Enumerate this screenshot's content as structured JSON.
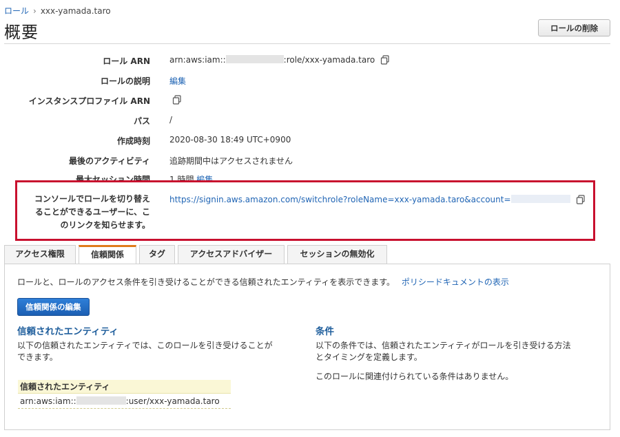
{
  "breadcrumb": {
    "parent": "ロール",
    "separator": "›",
    "current": "xxx-yamada.taro"
  },
  "page_title": "概要",
  "delete_button": "ロールの削除",
  "summary": {
    "role_arn": {
      "label": "ロール ARN",
      "prefix": "arn:aws:iam::",
      "suffix": ":role/xxx-yamada.taro"
    },
    "description": {
      "label": "ロールの説明",
      "link": "編集"
    },
    "instance_profile": {
      "label": "インスタンスプロファイル ARN"
    },
    "path": {
      "label": "パス",
      "value": "/"
    },
    "created": {
      "label": "作成時刻",
      "value": "2020-08-30 18:49 UTC+0900"
    },
    "last_activity": {
      "label": "最後のアクティビティ",
      "value": "追跡期間中はアクセスされません"
    },
    "max_session": {
      "label": "最大セッション時間",
      "value": "1 時間",
      "link": "編集"
    },
    "switch_link": {
      "label_lines": [
        "コンソールでロールを切り替え",
        "ることができるユーザーに、こ",
        "のリンクを知らせます。"
      ],
      "url": "https://signin.aws.amazon.com/switchrole?roleName=xxx-yamada.taro&account="
    }
  },
  "tabs": [
    {
      "label": "アクセス権限",
      "active": false
    },
    {
      "label": "信頼関係",
      "active": true
    },
    {
      "label": "タグ",
      "active": false
    },
    {
      "label": "アクセスアドバイザー",
      "active": false
    },
    {
      "label": "セッションの無効化",
      "active": false
    }
  ],
  "trust_panel": {
    "intro": "ロールと、ロールのアクセス条件を引き受けることができる信頼されたエンティティを表示できます。",
    "intro_link": "ポリシードキュメントの表示",
    "edit_button": "信頼関係の編集",
    "entities": {
      "title": "信頼されたエンティティ",
      "desc_lines": [
        "以下の信頼されたエンティティでは、このロールを引き受けることが",
        "できます。"
      ],
      "table_header": "信頼されたエンティティ",
      "row_prefix": "arn:aws:iam::",
      "row_suffix": ":user/xxx-yamada.taro"
    },
    "conditions": {
      "title": "条件",
      "desc_lines": [
        "以下の条件では、信頼されたエンティティがロールを引き受ける方法",
        "とタイミングを定義します。"
      ],
      "none_text": "このロールに関連付けられている条件はありません。"
    }
  },
  "colors": {
    "link": "#1f64b4",
    "highlight_border": "#c8102e",
    "active_tab": "#e07b1a",
    "primary_button": "#1f64b4"
  }
}
